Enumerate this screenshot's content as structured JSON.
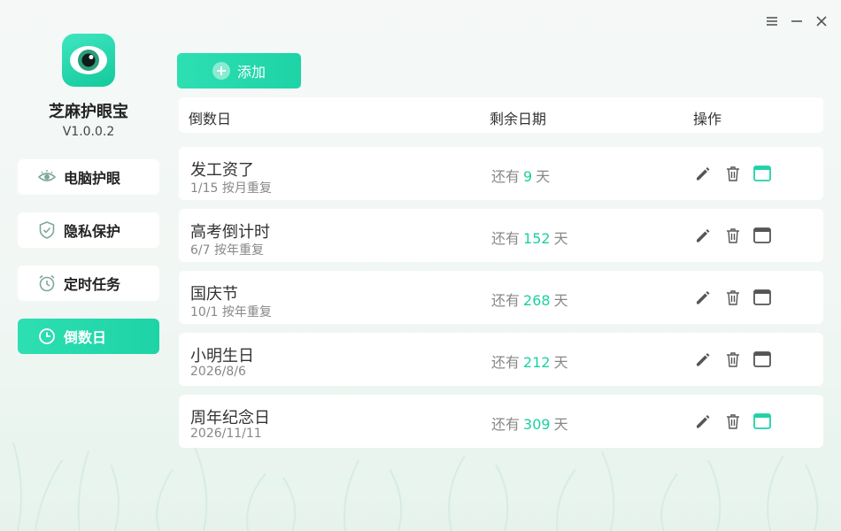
{
  "app": {
    "name": "芝麻护眼宝",
    "version": "V1.0.0.2"
  },
  "window_controls": [
    "menu-icon",
    "minimize-icon",
    "close-icon"
  ],
  "nav": [
    {
      "label": "电脑护眼",
      "icon": "eye-icon",
      "active": false
    },
    {
      "label": "隐私保护",
      "icon": "shield-check-icon",
      "active": false
    },
    {
      "label": "定时任务",
      "icon": "alarm-clock-icon",
      "active": false
    },
    {
      "label": "倒数日",
      "icon": "clock-icon",
      "active": true
    }
  ],
  "toolbar": {
    "add_label": "添加",
    "add_icon": "plus-icon"
  },
  "table": {
    "headers": [
      "倒数日",
      "剩余日期",
      "操作"
    ],
    "remain_prefix": "还有",
    "remain_suffix": "天",
    "rows": [
      {
        "title": "发工资了",
        "sub": "1/15 按月重复",
        "days": "9",
        "display_active": true
      },
      {
        "title": "高考倒计时",
        "sub": "6/7 按年重复",
        "days": "152",
        "display_active": false
      },
      {
        "title": "国庆节",
        "sub": "10/1 按年重复",
        "days": "268",
        "display_active": false
      },
      {
        "title": "小明生日",
        "sub": "2026/8/6",
        "days": "212",
        "display_active": false
      },
      {
        "title": "周年纪念日",
        "sub": "2026/11/11",
        "days": "309",
        "display_active": true
      }
    ],
    "actions": [
      "edit-icon",
      "trash-icon",
      "desktop-widget-icon"
    ]
  },
  "colors": {
    "accent": "#1ed3a6",
    "text_primary": "#333333",
    "text_muted": "#888888",
    "icon": "#555555"
  }
}
